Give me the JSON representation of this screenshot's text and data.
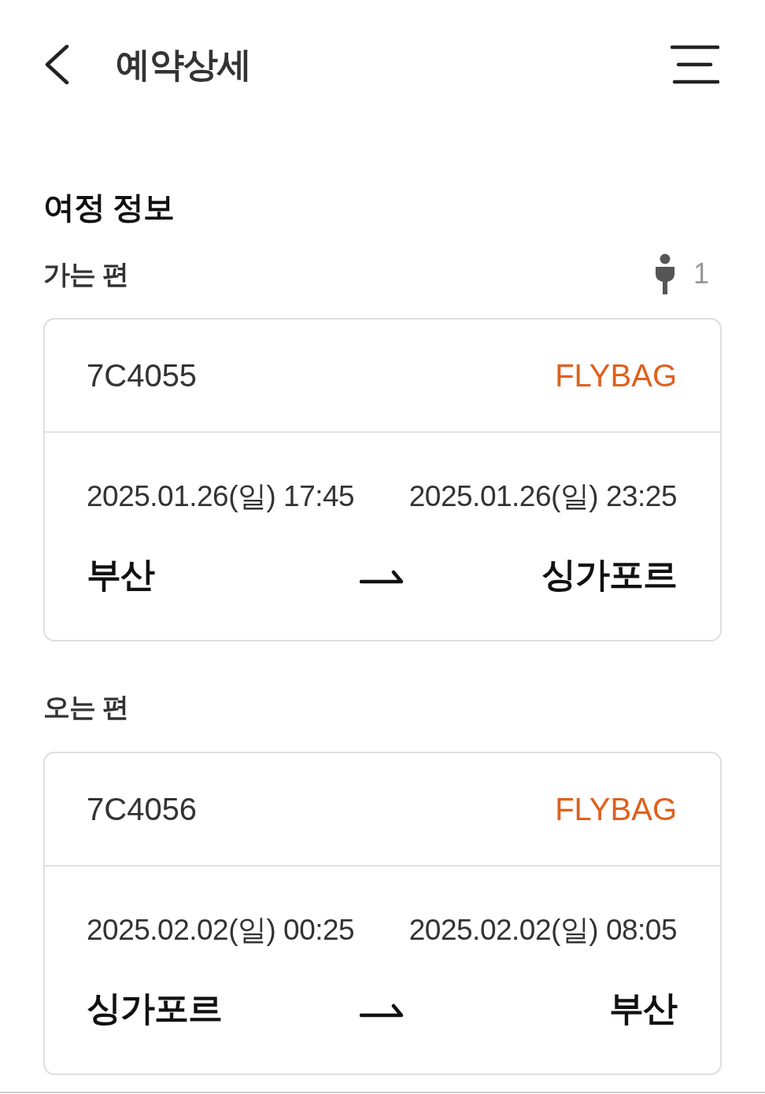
{
  "header": {
    "title": "예약상세"
  },
  "section": {
    "title": "여정 정보"
  },
  "legs": [
    {
      "label": "가는 편",
      "passengers": "1",
      "flight": "7C4055",
      "fare": "FLYBAG",
      "departure_time": "2025.01.26(일) 17:45",
      "arrival_time": "2025.01.26(일) 23:25",
      "origin": "부산",
      "destination": "싱가포르"
    },
    {
      "label": "오는 편",
      "flight": "7C4056",
      "fare": "FLYBAG",
      "departure_time": "2025.02.02(일) 00:25",
      "arrival_time": "2025.02.02(일) 08:05",
      "origin": "싱가포르",
      "destination": "부산"
    }
  ]
}
